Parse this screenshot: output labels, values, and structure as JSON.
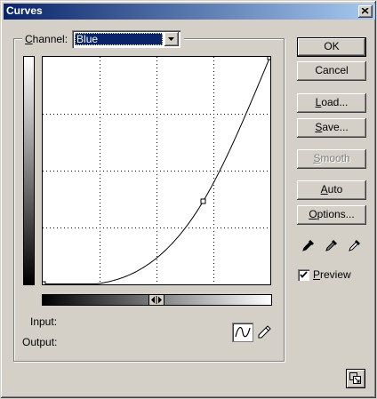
{
  "window": {
    "title": "Curves"
  },
  "channel": {
    "label_accel": "C",
    "label_rest": "hannel:",
    "value": "Blue"
  },
  "curve": {
    "points": [
      [
        0,
        0
      ],
      [
        180,
        93
      ],
      [
        255,
        255
      ]
    ]
  },
  "fields": {
    "input_label": "Input:",
    "output_label": "Output:"
  },
  "buttons": {
    "ok": "OK",
    "cancel": "Cancel",
    "load_accel": "L",
    "load_rest": "oad...",
    "save_accel": "S",
    "save_rest": "ave...",
    "smooth_accel": "S",
    "smooth_rest": "mooth",
    "auto_accel": "A",
    "auto_rest": "uto",
    "options_accel": "O",
    "options_rest": "ptions..."
  },
  "eyedroppers": [
    "black-eyedropper-icon",
    "gray-eyedropper-icon",
    "white-eyedropper-icon"
  ],
  "preview": {
    "accel": "P",
    "rest": "review",
    "checked": true
  },
  "colors": {
    "titlebar_start": "#0a246a",
    "titlebar_end": "#a6caf0",
    "face": "#d4d0c8"
  }
}
